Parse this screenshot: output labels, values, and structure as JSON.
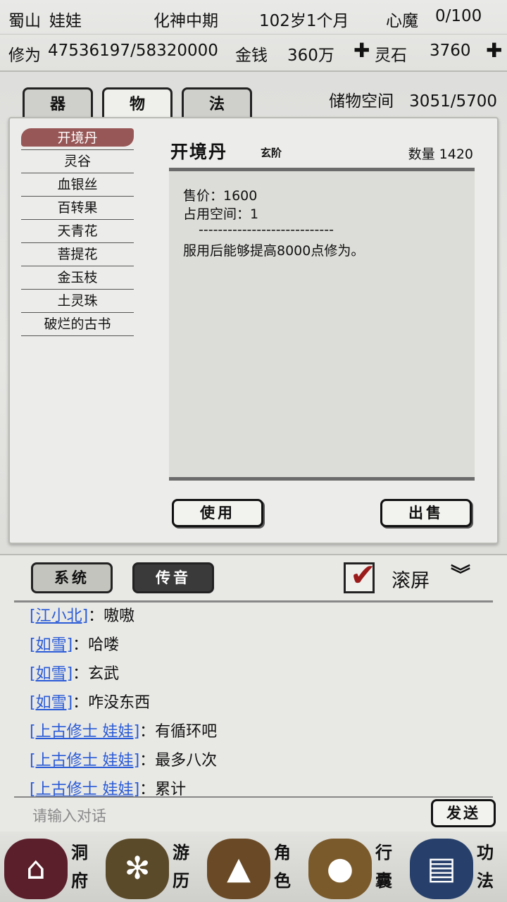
{
  "status": {
    "sect": "蜀山",
    "name": "娃娃",
    "realm": "化神中期",
    "age": "102岁1个月",
    "heart_demon_label": "心魔",
    "heart_demon_value": "0/100",
    "cultivation_label": "修为",
    "cultivation_value": "47536197/58320000",
    "money_label": "金钱",
    "money_value": "360万",
    "spirit_stone_label": "灵石",
    "spirit_stone_value": "3760"
  },
  "tabs": [
    "器",
    "物",
    "法"
  ],
  "storage": {
    "label": "储物空间",
    "value": "3051/5700"
  },
  "items": [
    "开境丹",
    "灵谷",
    "血银丝",
    "百转果",
    "天青花",
    "菩提花",
    "金玉枝",
    "土灵珠",
    "破烂的古书"
  ],
  "detail": {
    "title": "开境丹",
    "grade": "玄阶",
    "qty_label": "数量",
    "qty_value": "1420",
    "price": "售价：1600",
    "space": "占用空间：1",
    "separator": "----------------------------",
    "effect": "服用后能够提高8000点修为。"
  },
  "buttons": {
    "use": "使用",
    "sell": "出售"
  },
  "chat": {
    "tab_system": "系统",
    "tab_voice": "传音",
    "scroll_label": "滚屏",
    "messages": [
      {
        "who": "[江小北]",
        "text": "：嗷嗷"
      },
      {
        "who": "[如雪]",
        "text": "：哈喽"
      },
      {
        "who": "[如雪]",
        "text": "：玄武"
      },
      {
        "who": "[如雪]",
        "text": "：咋没东西"
      },
      {
        "who": "[上古修士 娃娃]",
        "text": "：有循环吧"
      },
      {
        "who": "[上古修士 娃娃]",
        "text": "：最多八次"
      },
      {
        "who": "[上古修士 娃娃]",
        "text": "：累计"
      }
    ],
    "input_placeholder": "请输入对话",
    "send": "发送"
  },
  "nav": [
    {
      "label": "洞府",
      "icon": "cave-dwelling-icon",
      "color": "#5a1f2a"
    },
    {
      "label": "游历",
      "icon": "grass-travel-icon",
      "color": "#5a4a2a"
    },
    {
      "label": "角色",
      "icon": "straw-hat-character-icon",
      "color": "#6a4a26"
    },
    {
      "label": "行囊",
      "icon": "bag-icon",
      "color": "#7a5a2a"
    },
    {
      "label": "功法",
      "icon": "book-icon",
      "color": "#27406b"
    }
  ]
}
